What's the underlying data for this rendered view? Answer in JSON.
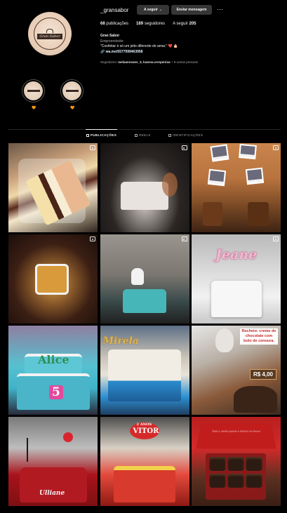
{
  "profile": {
    "username": "_gransabor",
    "follow_button": "A seguir",
    "message_button": "Enviar mensagem",
    "more_icon": "ellipsis-icon",
    "avatar_text": "Gran Sabor",
    "stats": {
      "posts_count": "68",
      "posts_label": "publicações",
      "followers_count": "189",
      "followers_label": "seguidores",
      "following_label": "A seguir",
      "following_count": "205"
    },
    "bio": {
      "name": "Gran Sabor",
      "category": "Empreendedor",
      "quote": "\"Confeitar é só um jeito diferente de amar.\" ❤️ 🎂",
      "link": "wa.me/5577999463958"
    },
    "followed_by": {
      "prefix": "Seguidores: ",
      "names": "taelaanovaes_3, luanna.cerqueiraa",
      "suffix": " + 9 outras pessoas"
    }
  },
  "highlights": [
    {
      "label": "🧡"
    },
    {
      "label": "🧡"
    }
  ],
  "tabs": [
    {
      "label": "PUBLICAÇÕES",
      "active": true
    },
    {
      "label": "REELS",
      "active": false
    },
    {
      "label": "IDENTIFICAÇÕES",
      "active": false
    }
  ],
  "posts": {
    "p6_text": "Jeane",
    "p7_text": "Alice",
    "p7_number": "5",
    "p8_text": "Mirela",
    "p9_note": "Recheio: creme de chocolate com bolo de cenoura.",
    "p9_price": "R$ 4,00",
    "p10_text": "Ulliane",
    "p11_text": "VITOR",
    "p11_sub": "2 ANOS",
    "p12_box_text": "Toda a minha paixão e delícia em doces"
  },
  "colors": {
    "background": "#000000",
    "button": "#363636",
    "muted_text": "#a8a8a8",
    "link": "#e0f1ff"
  }
}
